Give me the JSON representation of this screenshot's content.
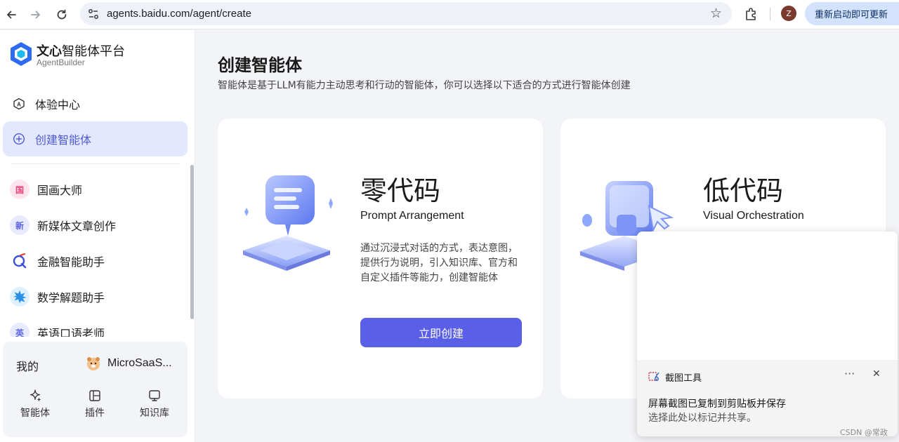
{
  "browser": {
    "url": "agents.baidu.com/agent/create",
    "profile_initial": "Z",
    "update_label": "重新启动即可更新"
  },
  "brand": {
    "name_bold": "文心",
    "name_rest": "智能体平台",
    "sub": "AgentBuilder"
  },
  "sidebar": {
    "menu": [
      {
        "label": "体验中心",
        "icon": "agent-a-icon"
      },
      {
        "label": "创建智能体",
        "icon": "plus-circle-icon",
        "active": true
      }
    ],
    "agents": [
      {
        "label": "国画大师",
        "avatar": "国",
        "color": "#e8457a"
      },
      {
        "label": "新媒体文章创作",
        "avatar": "新",
        "color": "#5b63e6"
      },
      {
        "label": "金融智能助手",
        "avatar": "",
        "color": "#e63b2e"
      },
      {
        "label": "数学解题助手",
        "avatar": "",
        "color": "#2a8fe6"
      },
      {
        "label": "英语口语老师",
        "avatar": "英",
        "color": "#5b63e6"
      }
    ],
    "mine": {
      "label": "我的",
      "user": "MicroSaaS...",
      "tools": [
        {
          "label": "智能体",
          "icon": "sparkle-icon"
        },
        {
          "label": "插件",
          "icon": "plugin-icon"
        },
        {
          "label": "知识库",
          "icon": "knowledge-icon"
        }
      ]
    }
  },
  "main": {
    "title": "创建智能体",
    "subtitle": "智能体是基于LLM有能力主动思考和行动的智能体，你可以选择以下适合的方式进行智能体创建",
    "cards": [
      {
        "title": "零代码",
        "subtitle": "Prompt Arrangement",
        "desc_lines": [
          "通过沉浸式对话的方式，表达意图，",
          "提供行为说明，引入知识库、官方和",
          "自定义插件等能力，创建智能体"
        ],
        "button": "立即创建"
      },
      {
        "title": "低代码",
        "subtitle": "Visual Orchestration"
      }
    ]
  },
  "toast": {
    "app": "截图工具",
    "more": "···",
    "close": "✕",
    "message": "屏幕截图已复制到剪贴板并保存",
    "sub": "选择此处以标记并共享。"
  },
  "watermark": "CSDN @常政"
}
